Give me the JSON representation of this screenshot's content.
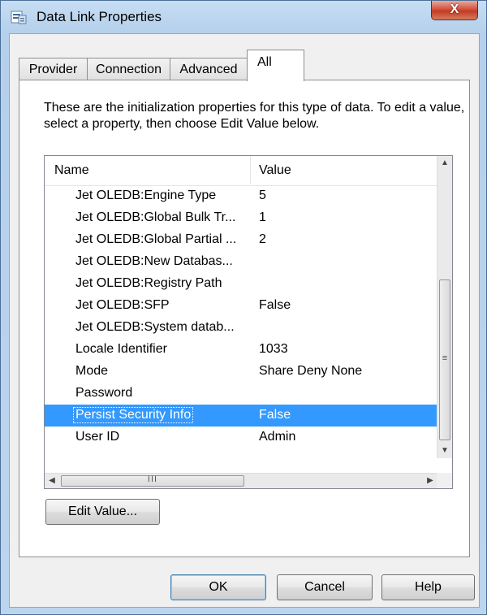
{
  "window": {
    "title": "Data Link Properties",
    "close_glyph": "X",
    "title_icon": "data-link-icon"
  },
  "tabs": [
    {
      "label": "Provider",
      "active": false
    },
    {
      "label": "Connection",
      "active": false
    },
    {
      "label": "Advanced",
      "active": false
    },
    {
      "label": "All",
      "active": true
    }
  ],
  "panel": {
    "description": "These are the initialization properties for this type of data. To edit a value, select a property, then choose Edit Value below."
  },
  "properties": {
    "columns": {
      "name": "Name",
      "value": "Value"
    },
    "rows": [
      {
        "name": "Jet OLEDB:Engine Type",
        "value": "5"
      },
      {
        "name": "Jet OLEDB:Global Bulk Tr...",
        "value": "1"
      },
      {
        "name": "Jet OLEDB:Global Partial ...",
        "value": "2"
      },
      {
        "name": "Jet OLEDB:New Databas...",
        "value": ""
      },
      {
        "name": "Jet OLEDB:Registry Path",
        "value": ""
      },
      {
        "name": "Jet OLEDB:SFP",
        "value": "False"
      },
      {
        "name": "Jet OLEDB:System datab...",
        "value": ""
      },
      {
        "name": "Locale Identifier",
        "value": "1033"
      },
      {
        "name": "Mode",
        "value": "Share Deny None"
      },
      {
        "name": "Password",
        "value": ""
      },
      {
        "name": "Persist Security Info",
        "value": "False",
        "selected": true
      },
      {
        "name": "User ID",
        "value": "Admin"
      }
    ],
    "selection_color": "#3399ff"
  },
  "buttons": {
    "edit_value": "Edit Value...",
    "ok": "OK",
    "cancel": "Cancel",
    "help": "Help"
  }
}
